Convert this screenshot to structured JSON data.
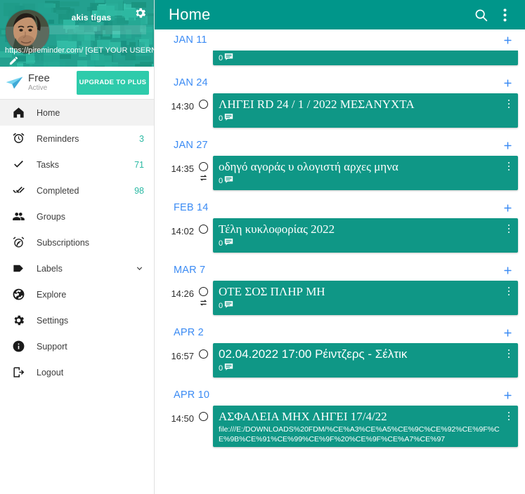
{
  "sidebar": {
    "profile": {
      "name": "akis tigas",
      "url": "https://pireminder.com/ [GET YOUR USERNAME]",
      "gear_icon": "gear-icon",
      "edit_icon": "pencil-icon",
      "avatar_alt": "akis tigas"
    },
    "plan": {
      "icon": "paper-plane-icon",
      "name": "Free",
      "status": "Active",
      "upgrade_label": "UPGRADE TO PLUS",
      "upgrade_color": "#2ecbab"
    },
    "items": [
      {
        "icon": "home-icon",
        "label": "Home",
        "badge": "",
        "active": true,
        "chevron": false
      },
      {
        "icon": "alarm-clock-icon",
        "label": "Reminders",
        "badge": "3",
        "active": false,
        "chevron": false
      },
      {
        "icon": "check-icon",
        "label": "Tasks",
        "badge": "71",
        "active": false,
        "chevron": false
      },
      {
        "icon": "double-check-icon",
        "label": "Completed",
        "badge": "98",
        "active": false,
        "chevron": false
      },
      {
        "icon": "group-icon",
        "label": "Groups",
        "badge": "",
        "active": false,
        "chevron": false
      },
      {
        "icon": "subscription-icon",
        "label": "Subscriptions",
        "badge": "",
        "active": false,
        "chevron": false
      },
      {
        "icon": "label-tag-icon",
        "label": "Labels",
        "badge": "",
        "active": false,
        "chevron": true
      },
      {
        "icon": "globe-icon",
        "label": "Explore",
        "badge": "",
        "active": false,
        "chevron": false
      },
      {
        "icon": "gear-icon",
        "label": "Settings",
        "badge": "",
        "active": false,
        "chevron": false
      },
      {
        "icon": "info-icon",
        "label": "Support",
        "badge": "",
        "active": false,
        "chevron": false
      },
      {
        "icon": "logout-icon",
        "label": "Logout",
        "badge": "",
        "active": false,
        "chevron": false
      }
    ],
    "badge_color": "#2ab9a3"
  },
  "topbar": {
    "title": "Home",
    "search_icon": "search-icon",
    "overflow_icon": "kebab-menu-icon",
    "background": "#00968a"
  },
  "colors": {
    "card": "#0f9786",
    "date_header": "#3b8bf4",
    "accent": "#2ecbab"
  },
  "groups": [
    {
      "date": "JAN 11",
      "add_label": "+",
      "clipped": true,
      "items": [
        {
          "time": "",
          "title": "",
          "note": "",
          "comments": "0",
          "repeat": false
        }
      ]
    },
    {
      "date": "JAN 24",
      "add_label": "+",
      "clipped": false,
      "items": [
        {
          "time": "14:30",
          "title": "ΛΗΓΕΙ RD  24 / 1 / 2022 ΜΕΣΑΝΥΧΤΑ",
          "note": "",
          "comments": "0",
          "repeat": false,
          "serif": true
        }
      ]
    },
    {
      "date": "JAN 27",
      "add_label": "+",
      "clipped": false,
      "items": [
        {
          "time": "14:35",
          "title": "οδηγό αγοράς υ  ολογιστή αρχες μηνα",
          "note": "",
          "comments": "0",
          "repeat": true,
          "serif": true
        }
      ]
    },
    {
      "date": "FEB 14",
      "add_label": "+",
      "clipped": false,
      "items": [
        {
          "time": "14:02",
          "title": "Τέλη κυκλοφορίας 2022",
          "note": "",
          "comments": "0",
          "repeat": false,
          "serif": true
        }
      ]
    },
    {
      "date": "MAR 7",
      "add_label": "+",
      "clipped": false,
      "items": [
        {
          "time": "14:26",
          "title": "ΟΤΕ ΣΟΣ ΠΛΗΡ   ΜΗ",
          "note": "",
          "comments": "0",
          "repeat": true,
          "serif": true
        }
      ]
    },
    {
      "date": "APR 2",
      "add_label": "+",
      "clipped": false,
      "items": [
        {
          "time": "16:57",
          "title": "02.04.2022 17:00  Ρέιντζερς -   Σέλτικ",
          "note": "",
          "comments": "0",
          "repeat": false,
          "serif": false
        }
      ]
    },
    {
      "date": "APR 10",
      "add_label": "+",
      "clipped": false,
      "items": [
        {
          "time": "14:50",
          "title": "ΑΣΦΑΛΕΙΑ ΜΗΧ ΛΗΓΕΙ 17/4/22",
          "note": "file:///E:/DOWNLOADS%20FDM/%CE%A3%CE%A5%CE%9C%CE%92%CE%9F%CE%9B%CE%91%CE%99%CE%9F%20%CE%9F%CE%A7%CE%97",
          "comments": "",
          "repeat": false,
          "serif": true
        }
      ]
    }
  ]
}
